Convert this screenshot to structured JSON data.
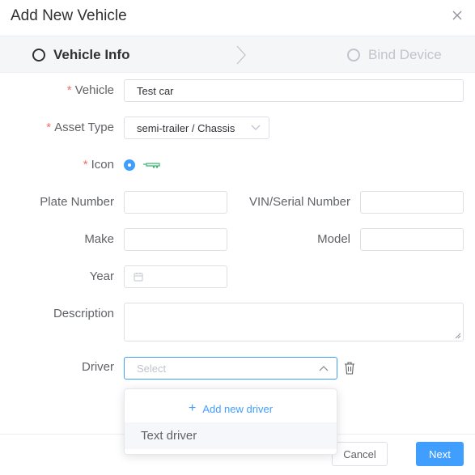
{
  "dialog": {
    "title": "Add New Vehicle"
  },
  "steps": [
    {
      "label": "Vehicle Info",
      "active": true
    },
    {
      "label": "Bind Device",
      "active": false
    }
  ],
  "form": {
    "required_mark": "*",
    "vehicle": {
      "label": "Vehicle",
      "value": "Test car"
    },
    "asset_type": {
      "label": "Asset Type",
      "value": "semi-trailer / Chassis"
    },
    "icon": {
      "label": "Icon",
      "selected_icon": "trailer-icon"
    },
    "plate_number": {
      "label": "Plate Number",
      "value": ""
    },
    "vin": {
      "label": "VIN/Serial Number",
      "value": ""
    },
    "make": {
      "label": "Make",
      "value": ""
    },
    "model": {
      "label": "Model",
      "value": ""
    },
    "year": {
      "label": "Year",
      "value": ""
    },
    "description": {
      "label": "Description",
      "value": ""
    },
    "driver": {
      "label": "Driver",
      "placeholder": "Select"
    }
  },
  "driver_dropdown": {
    "add_label": "Add new driver",
    "options": [
      "Text driver"
    ]
  },
  "footer": {
    "cancel_label": "Cancel",
    "next_label": "Next"
  },
  "colors": {
    "primary": "#409eff",
    "required": "#f56c6c",
    "icon_green": "#3cb371"
  }
}
